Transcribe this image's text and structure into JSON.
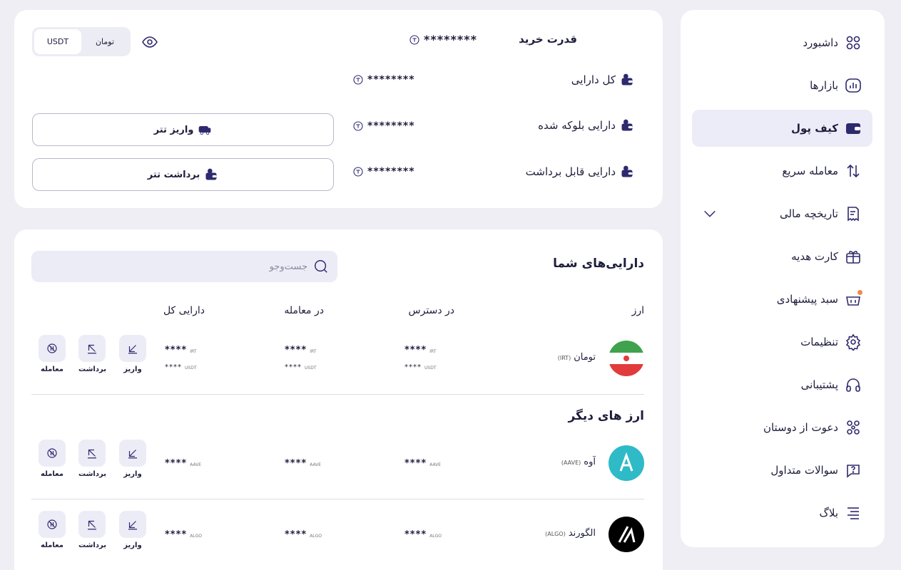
{
  "sidebar": {
    "items": [
      {
        "label": "داشبورد",
        "icon": "grid-icon"
      },
      {
        "label": "بازارها",
        "icon": "chart-icon"
      },
      {
        "label": "کیف پول",
        "icon": "wallet-icon",
        "active": true
      },
      {
        "label": "معامله سریع",
        "icon": "swap-arrows-icon"
      },
      {
        "label": "تاریخچه مالی",
        "icon": "receipt-icon"
      },
      {
        "label": "کارت هدیه",
        "icon": "gift-icon"
      },
      {
        "label": "سبد پیشنهادی",
        "icon": "basket-icon"
      },
      {
        "label": "تنظیمات",
        "icon": "gear-icon"
      },
      {
        "label": "پشتیبانی",
        "icon": "headphones-icon"
      },
      {
        "label": "دعوت از دوستان",
        "icon": "users-icon"
      },
      {
        "label": "سوالات متداول",
        "icon": "question-icon"
      },
      {
        "label": "بلاگ",
        "icon": "blog-icon"
      }
    ]
  },
  "balance": {
    "currency_toggle": {
      "options": [
        "USDT",
        "تومان"
      ],
      "selected": "USDT"
    },
    "purchasing_power": {
      "label": "قدرت خرید",
      "value": "********"
    },
    "rows": [
      {
        "label": "کل دارایی",
        "value": "********"
      },
      {
        "label": "دارایی بلوکه شده",
        "value": "********"
      },
      {
        "label": "دارایی قابل برداشت",
        "value": "********"
      }
    ],
    "deposit_button": "واریز تتر",
    "withdraw_button": "برداشت تتر"
  },
  "assets": {
    "title": "دارایی‌های شما",
    "search_placeholder": "جست‌وجو",
    "columns": {
      "currency": "ارز",
      "available": "در دسترس",
      "in_trade": "در معامله",
      "total": "دارایی کل"
    },
    "other_title": "ارز های دیگر",
    "actions": {
      "deposit": "واریز",
      "withdraw": "برداشت",
      "trade": "معامله"
    },
    "toman": {
      "name": "تومان",
      "symbol": "(IRT)",
      "masked": "****",
      "unit": "IRT",
      "sub_masked": "****",
      "sub_unit": "USDT"
    },
    "aave": {
      "name": "آوه",
      "symbol": "(AAVE)",
      "masked": "****",
      "unit": "AAVE"
    },
    "algo": {
      "name": "الگورند",
      "symbol": "(ALGO)",
      "masked": "****",
      "unit": "ALGO"
    }
  },
  "colors": {
    "accent": "#2e2a6e",
    "active_bg": "#ececf8",
    "aave": "#2ebac6",
    "algo": "#000000",
    "notify": "#f08a4b"
  }
}
